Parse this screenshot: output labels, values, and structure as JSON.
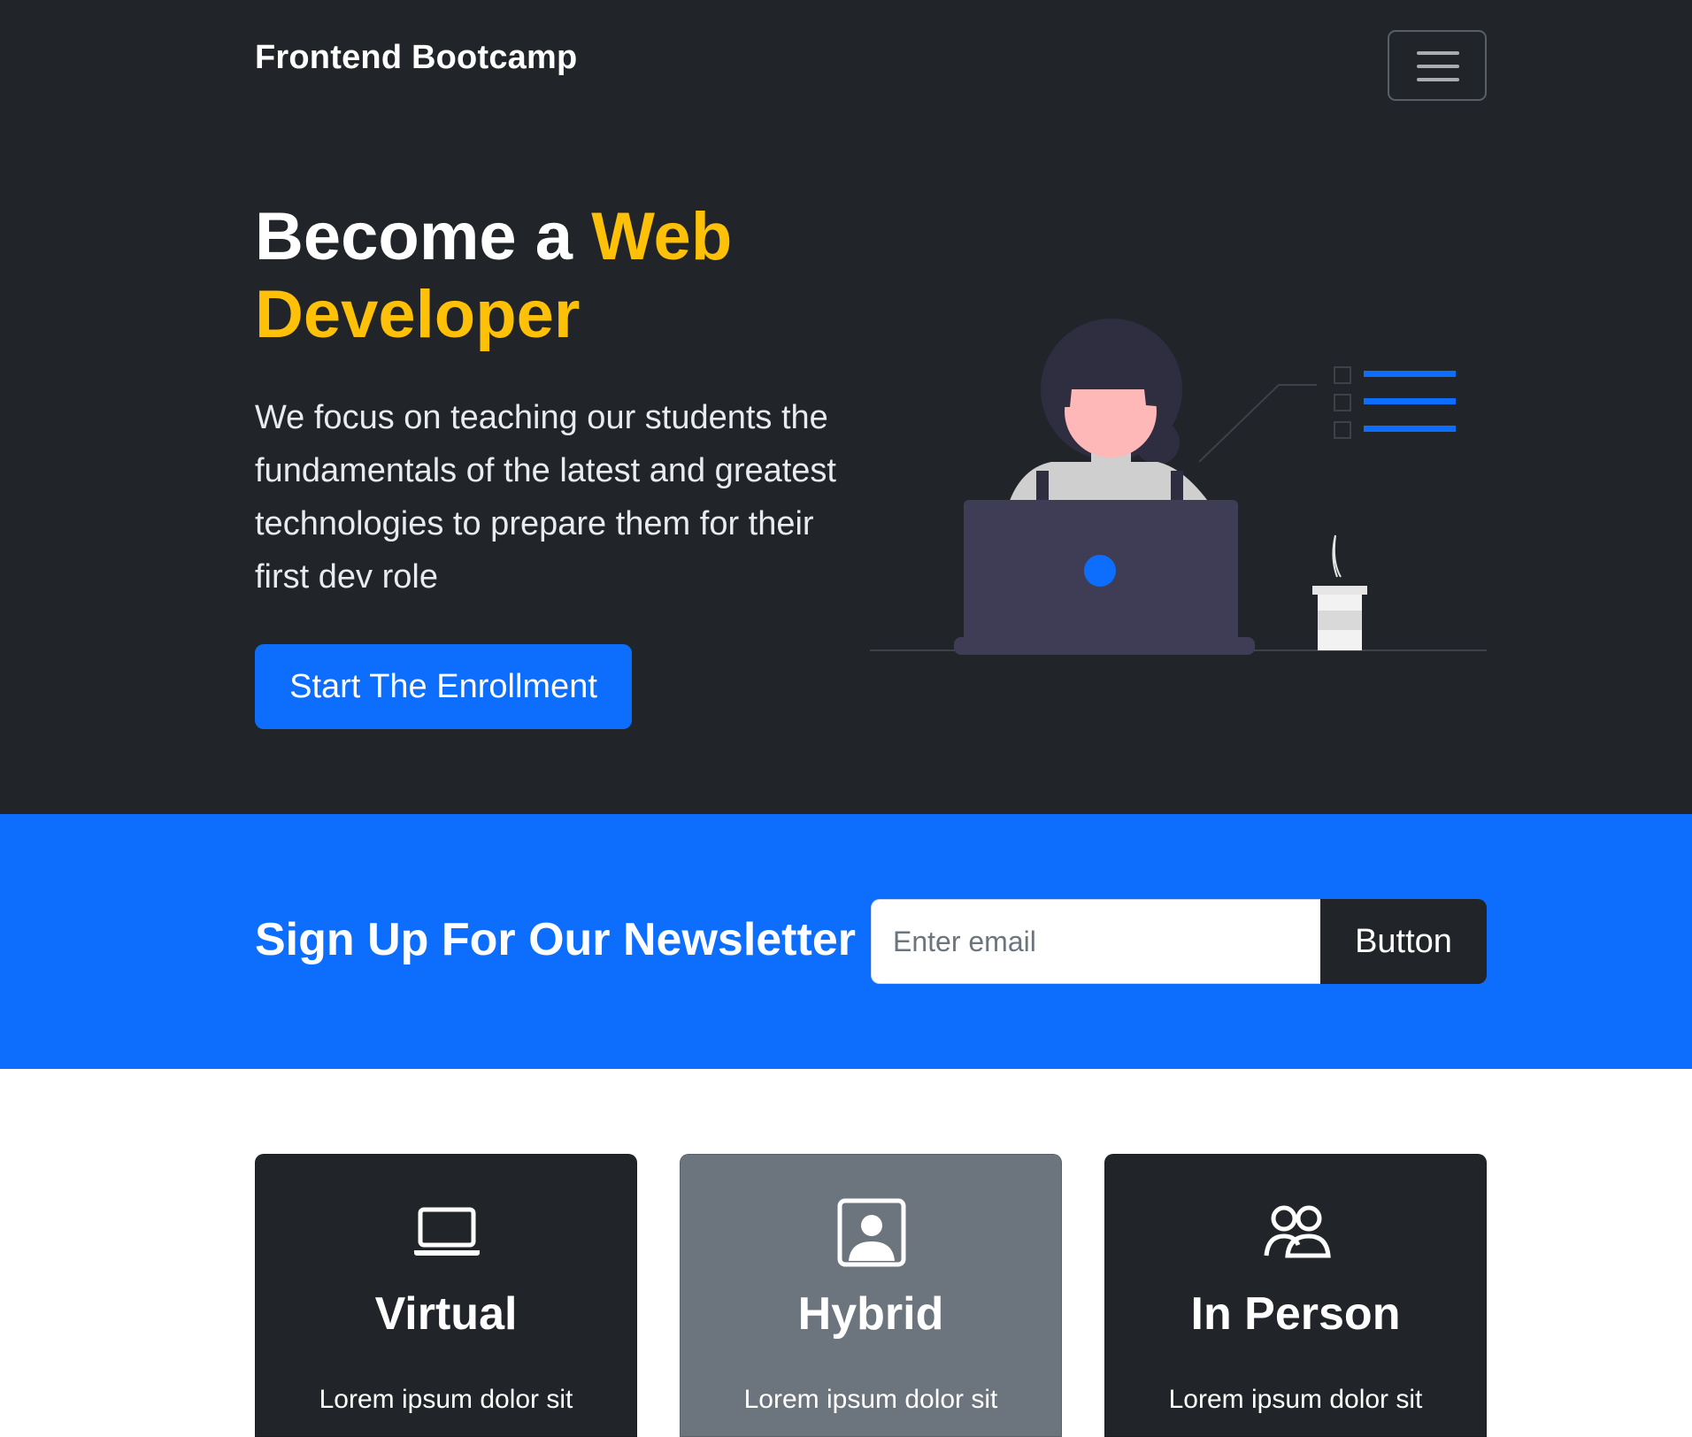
{
  "navbar": {
    "brand": "Frontend Bootcamp",
    "toggler_icon": "hamburger-menu-icon"
  },
  "hero": {
    "title_prefix": "Become a ",
    "title_accent": "Web Developer",
    "lead": "We focus on teaching our students the fundamentals of the latest and greatest technologies to prepare them for their first dev role",
    "cta_label": "Start The Enrollment",
    "illustration_icon": "developer-at-laptop-illustration"
  },
  "newsletter": {
    "title": "Sign Up For Our Newsletter",
    "email_placeholder": "Enter email",
    "email_value": "",
    "button_label": "Button"
  },
  "cards": [
    {
      "icon": "laptop-icon",
      "title": "Virtual",
      "text": "Lorem ipsum dolor sit"
    },
    {
      "icon": "person-badge-icon",
      "title": "Hybrid",
      "text": "Lorem ipsum dolor sit"
    },
    {
      "icon": "people-icon",
      "title": "In Person",
      "text": "Lorem ipsum dolor sit"
    }
  ],
  "colors": {
    "dark": "#212529",
    "primary": "#0d6efd",
    "warning": "#ffc107",
    "secondary": "#6c757d"
  }
}
